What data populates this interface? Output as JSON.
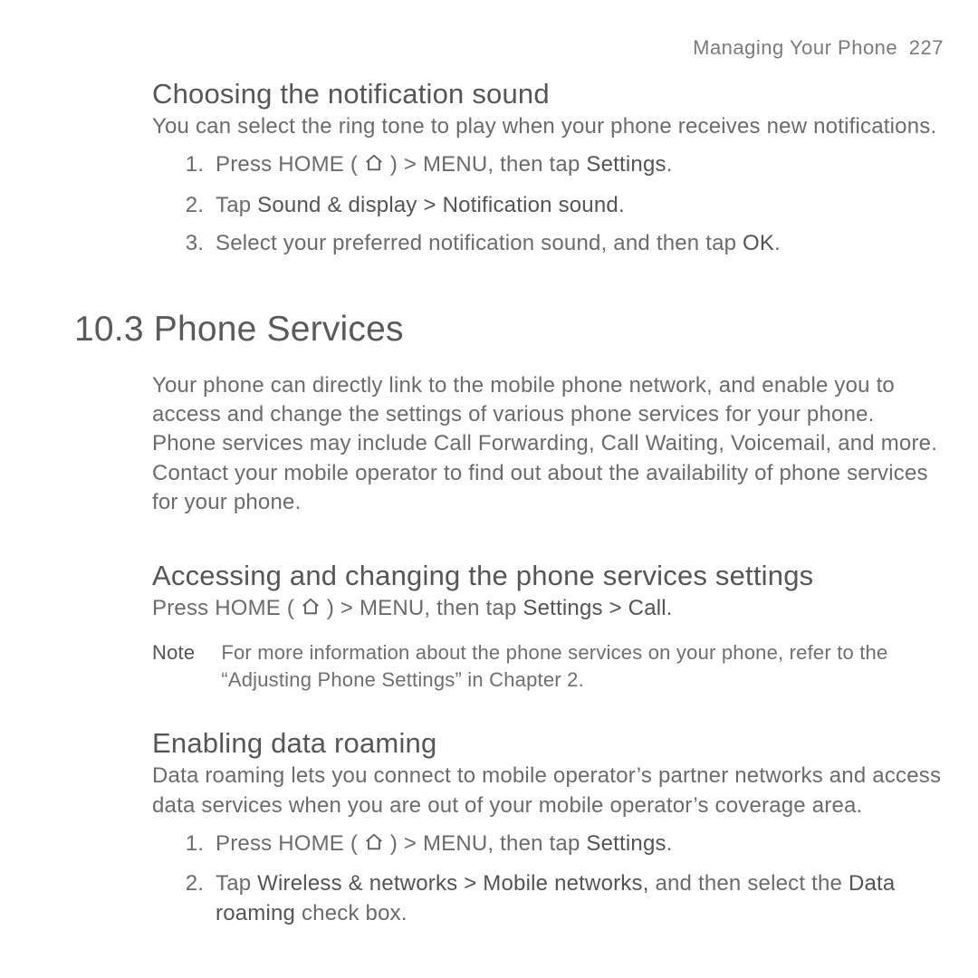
{
  "header": {
    "section": "Managing Your Phone",
    "page": "227"
  },
  "sub1": {
    "title": "Choosing the notification sound",
    "intro": "You can select the ring tone to play when your phone receives new notifications.",
    "steps": {
      "s1": {
        "pre": "Press HOME ( ",
        "post": " ) > MENU, then tap ",
        "settings": "Settings",
        "end": "."
      },
      "s2": {
        "pre": "Tap ",
        "path": "Sound & display > Notification sound."
      },
      "s3": {
        "pre": "Select your preferred notification sound, and then tap ",
        "ok": "OK",
        "end": "."
      }
    }
  },
  "section": {
    "num_title": "10.3  Phone Services",
    "intro": "Your phone can directly link to the mobile phone network, and enable you to access and change the settings of various phone services for your phone. Phone services may include Call Forwarding, Call Waiting, Voicemail, and more. Contact your mobile operator to find out about the availability of phone services for your phone."
  },
  "sub2": {
    "title": "Accessing and changing the phone services settings",
    "line": {
      "pre": "Press HOME ( ",
      "post": " ) > MENU, then tap ",
      "path": "Settings > Call."
    }
  },
  "note": {
    "label": "Note",
    "text": "For more information about the phone services on your phone, refer to the “Adjusting Phone Settings” in Chapter 2."
  },
  "sub3": {
    "title": "Enabling data roaming",
    "intro": "Data roaming lets you connect to mobile operator’s partner networks and access data services when you are out of your mobile operator’s coverage area.",
    "steps": {
      "s1": {
        "pre": "Press HOME ( ",
        "post": " ) > MENU, then tap ",
        "settings": "Settings",
        "end": "."
      },
      "s2": {
        "pre": "Tap ",
        "path": "Wireless & networks > Mobile networks,",
        "mid": " and then select the ",
        "roam": "Data roaming",
        "end": " check box."
      }
    }
  }
}
